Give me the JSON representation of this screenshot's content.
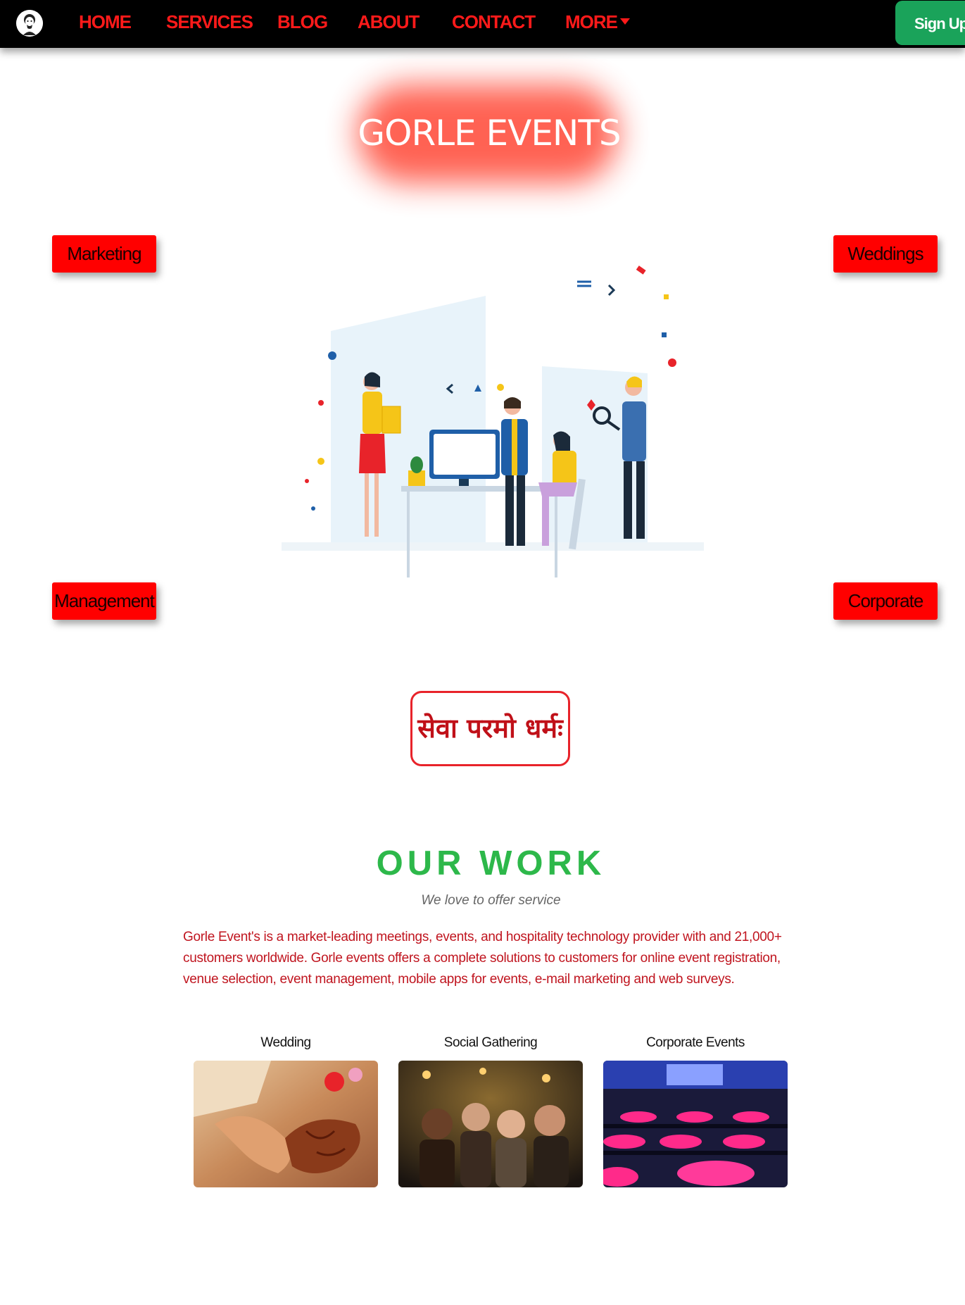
{
  "nav": {
    "items": [
      {
        "label": "HOME"
      },
      {
        "label": "SERVICES"
      },
      {
        "label": "BLOG"
      },
      {
        "label": "ABOUT"
      },
      {
        "label": "CONTACT"
      },
      {
        "label": "MORE"
      }
    ],
    "signup_label": "Sign Up"
  },
  "hero": {
    "title": "GORLE EVENTS"
  },
  "categories": {
    "top_left": "Marketing",
    "top_right": "Weddings",
    "bottom_left": "Management",
    "bottom_right": "Corporate"
  },
  "motto": "सेवा परमो धर्मः",
  "our_work": {
    "title": "OUR WORK",
    "subtitle": "We love to offer service",
    "description": "Gorle Event's is a market-leading meetings, events, and hospitality technology provider with and 21,000+ customers worldwide. Gorle events offers a complete solutions to customers for online event registration, venue selection, event management, mobile apps for events, e-mail marketing and web surveys."
  },
  "cards": [
    {
      "label": "Wedding"
    },
    {
      "label": "Social Gathering"
    },
    {
      "label": "Corporate Events"
    }
  ],
  "colors": {
    "nav_link": "#ff1a1a",
    "signup": "#1aa35a",
    "category": "#ff0000",
    "section_title": "#2db84a",
    "description": "#c0151f"
  }
}
